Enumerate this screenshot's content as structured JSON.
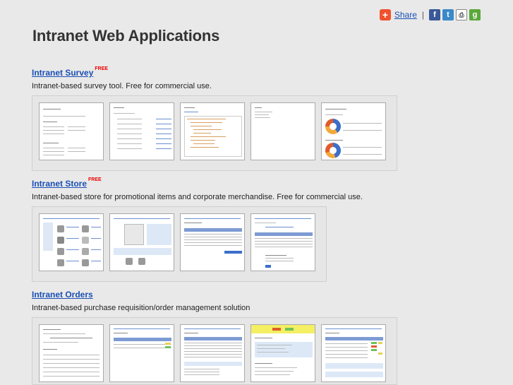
{
  "share": {
    "label": "Share",
    "separator": "|"
  },
  "page_title": "Intranet Web Applications",
  "sections": [
    {
      "title": "Intranet Survey",
      "badge": "FREE",
      "description": "Intranet-based survey tool. Free for commercial use."
    },
    {
      "title": "Intranet Store",
      "badge": "FREE",
      "description": "Intranet-based store for promotional items and corporate merchandise. Free for commercial use."
    },
    {
      "title": "Intranet Orders",
      "badge": "",
      "description": "Intranet-based purchase requisition/order management solution"
    }
  ],
  "icons": [
    "share-plus-icon",
    "facebook-icon",
    "twitter-icon",
    "print-icon",
    "google-icon"
  ],
  "colors": {
    "link": "#1a4fb5",
    "free_badge": "#e00000",
    "share_button": "#f0512f",
    "background": "#e9e9e9"
  }
}
